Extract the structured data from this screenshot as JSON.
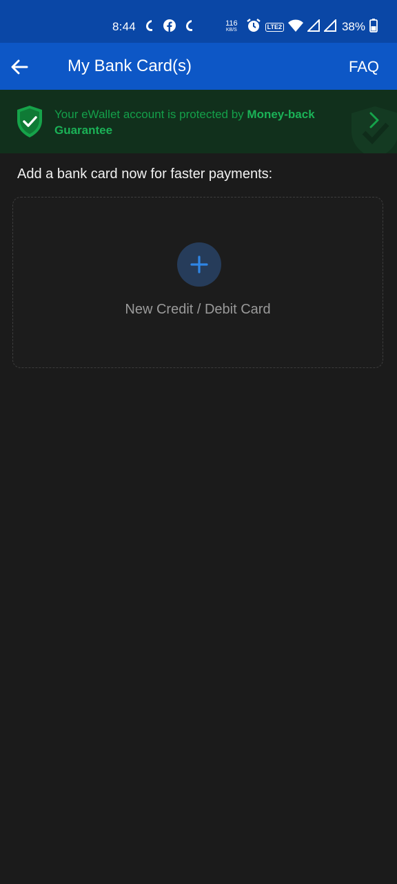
{
  "status_bar": {
    "time": "8:44",
    "net_speed_value": "116",
    "net_speed_unit": "KB/S",
    "volte_label": "LTE2",
    "battery_percent": "38%"
  },
  "app_bar": {
    "title": "My Bank Card(s)",
    "faq_label": "FAQ"
  },
  "banner": {
    "text_normal": "Your eWallet account is protected by ",
    "text_bold": "Money-back Guarantee"
  },
  "main": {
    "heading": "Add a bank card now for faster payments:",
    "add_card_label": "New Credit / Debit Card"
  },
  "colors": {
    "status_bar_bg": "#0a47a6",
    "app_bar_bg": "#0d57c6",
    "banner_bg": "#11301c",
    "banner_text": "#14a04a",
    "page_bg": "#1b1b1b",
    "plus_accent": "#2f86e6"
  }
}
